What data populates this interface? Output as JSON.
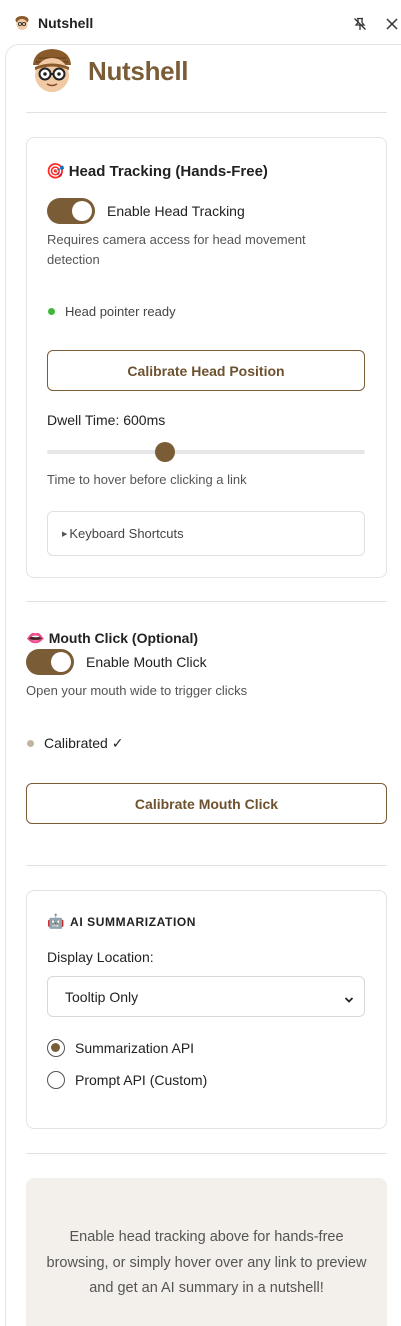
{
  "window": {
    "title": "Nutshell",
    "pin_icon": "pin-off-icon",
    "close_icon": "close-icon"
  },
  "brand": {
    "name": "Nutshell",
    "logo_icon": "nutshell-mascot-icon",
    "color": "#7a5c36"
  },
  "head_tracking": {
    "emoji": "🎯",
    "title": "Head Tracking (Hands-Free)",
    "toggle_label": "Enable Head Tracking",
    "toggle_on": true,
    "description": "Requires camera access for head movement detection",
    "status_text": "Head pointer ready",
    "status_color": "#3fb839",
    "calibrate_label": "Calibrate Head Position",
    "dwell_label": "Dwell Time: 600ms",
    "dwell_value_ms": 600,
    "dwell_fraction": 0.34,
    "dwell_hint": "Time to hover before clicking a link",
    "shortcuts_label": "Keyboard Shortcuts"
  },
  "mouth_click": {
    "emoji": "👄",
    "title": "Mouth Click (Optional)",
    "toggle_label": "Enable Mouth Click",
    "toggle_on": true,
    "description": "Open your mouth wide to trigger clicks",
    "status_text": "Calibrated ✓",
    "status_color": "#c2b59f",
    "calibrate_label": "Calibrate Mouth Click"
  },
  "ai": {
    "emoji": "🤖",
    "title": "AI SUMMARIZATION",
    "display_label": "Display Location:",
    "display_value": "Tooltip Only",
    "options": [
      {
        "label": "Summarization API",
        "checked": true
      },
      {
        "label": "Prompt API (Custom)",
        "checked": false
      }
    ]
  },
  "footer": {
    "text": "Enable head tracking above for hands-free browsing, or simply hover over any link to preview and get an AI summary in a nutshell!"
  }
}
